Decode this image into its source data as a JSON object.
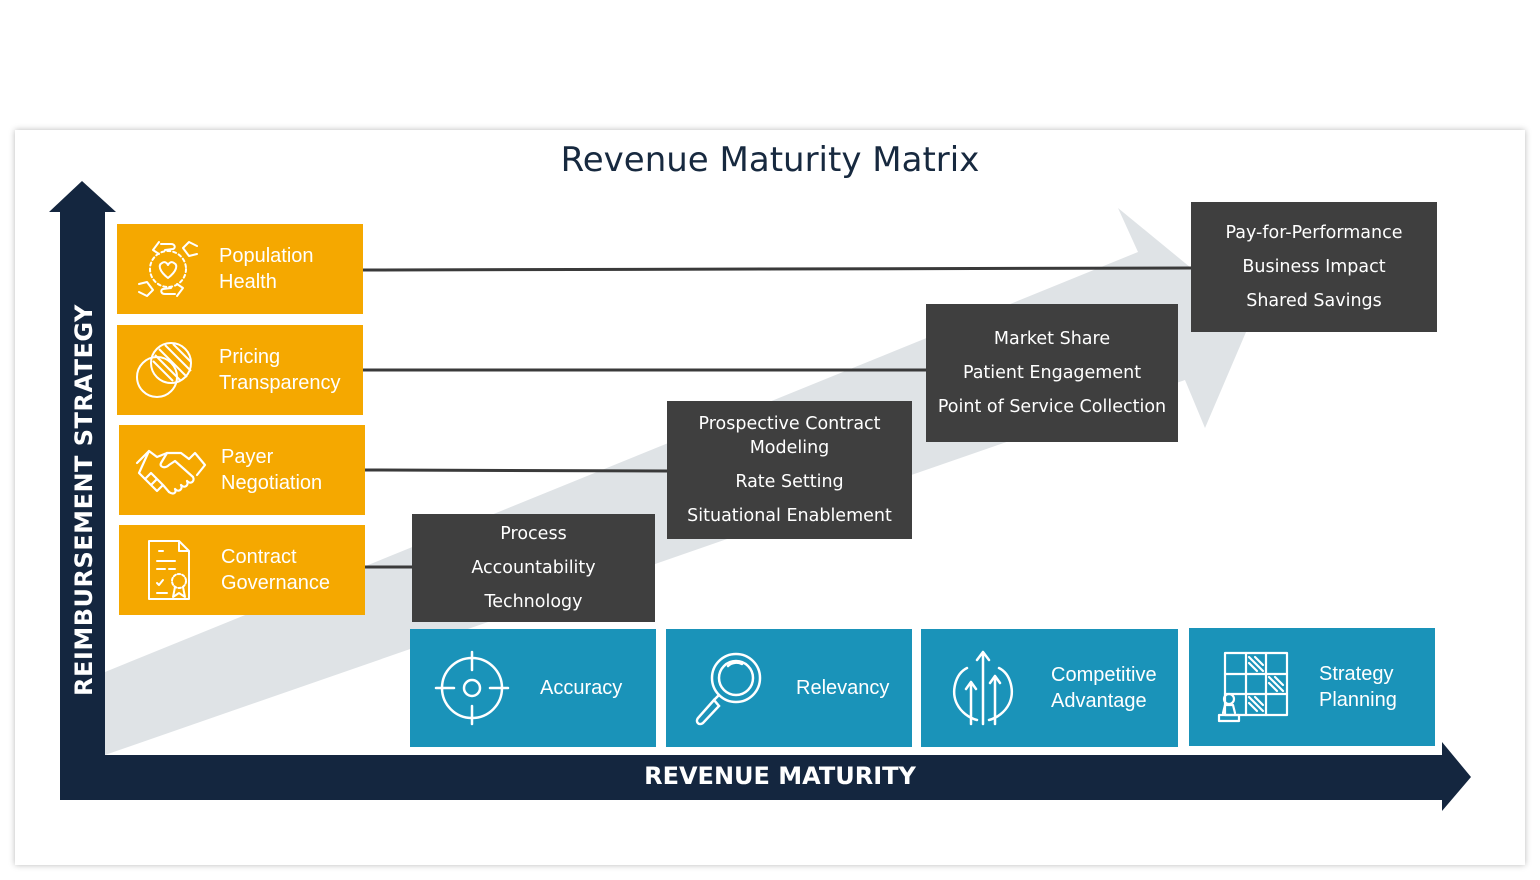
{
  "title": "Revenue Maturity Matrix",
  "axes": {
    "y_label": "REIMBURSEMENT STRATEGY",
    "x_label": "REVENUE MATURITY"
  },
  "colors": {
    "orange": "#f5a800",
    "dark_gray": "#3f3f3f",
    "teal": "#1a93b9",
    "navy": "#14263f",
    "light_arrow": "#dfe3e6"
  },
  "strategies": [
    {
      "label": "Population\nHealth",
      "icon": "hands-heart-icon"
    },
    {
      "label": "Pricing\nTransparency",
      "icon": "overlapping-circles-icon"
    },
    {
      "label": "Payer\nNegotiation",
      "icon": "handshake-icon"
    },
    {
      "label": "Contract\nGovernance",
      "icon": "certificate-document-icon"
    }
  ],
  "stages": [
    {
      "lines": [
        "Process",
        "Accountability",
        "Technology"
      ]
    },
    {
      "lines": [
        "Prospective Contract\nModeling",
        "Rate Setting",
        "Situational Enablement"
      ]
    },
    {
      "lines": [
        "Market Share",
        "Patient Engagement",
        "Point of Service Collection"
      ]
    },
    {
      "lines": [
        "Pay-for-Performance",
        "Business Impact",
        "Shared Savings"
      ]
    }
  ],
  "outcomes": [
    {
      "label": "Accuracy",
      "icon": "target-crosshair-icon"
    },
    {
      "label": "Relevancy",
      "icon": "magnifier-icon"
    },
    {
      "label": "Competitive\nAdvantage",
      "icon": "arrows-up-icon"
    },
    {
      "label": "Strategy\nPlanning",
      "icon": "chessboard-icon"
    }
  ]
}
